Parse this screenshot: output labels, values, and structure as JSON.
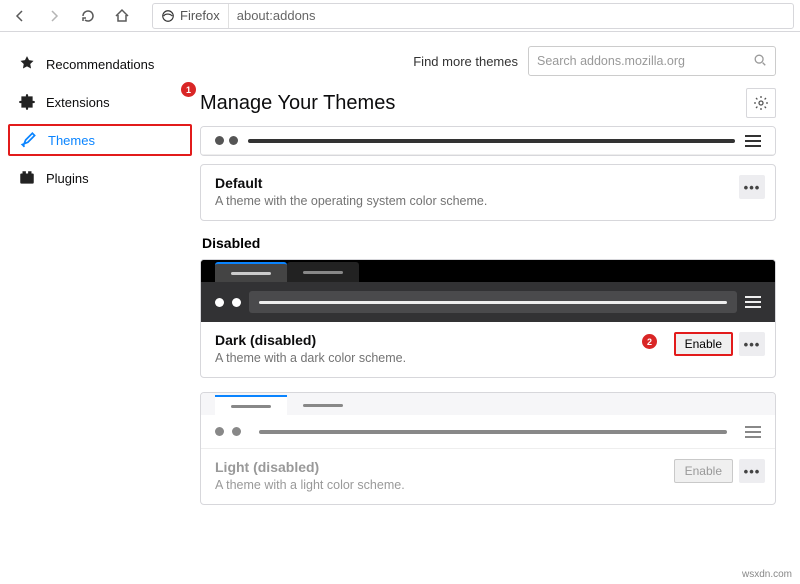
{
  "toolbar": {
    "identity": "Firefox",
    "url": "about:addons"
  },
  "header": {
    "find_more": "Find more themes",
    "search_placeholder": "Search addons.mozilla.org"
  },
  "page_title": "Manage Your Themes",
  "sidebar": {
    "items": [
      {
        "label": "Recommendations"
      },
      {
        "label": "Extensions"
      },
      {
        "label": "Themes"
      },
      {
        "label": "Plugins"
      }
    ]
  },
  "annotations": {
    "badge1": "1",
    "badge2": "2"
  },
  "sections": {
    "disabled_label": "Disabled"
  },
  "themes": {
    "default": {
      "name": "Default",
      "desc": "A theme with the operating system color scheme.",
      "dots": "•••"
    },
    "dark": {
      "name": "Dark (disabled)",
      "desc": "A theme with a dark color scheme.",
      "action": "Enable",
      "dots": "•••"
    },
    "light": {
      "name": "Light (disabled)",
      "desc": "A theme with a light color scheme.",
      "action": "Enable",
      "dots": "•••"
    }
  },
  "watermark": "wsxdn.com"
}
